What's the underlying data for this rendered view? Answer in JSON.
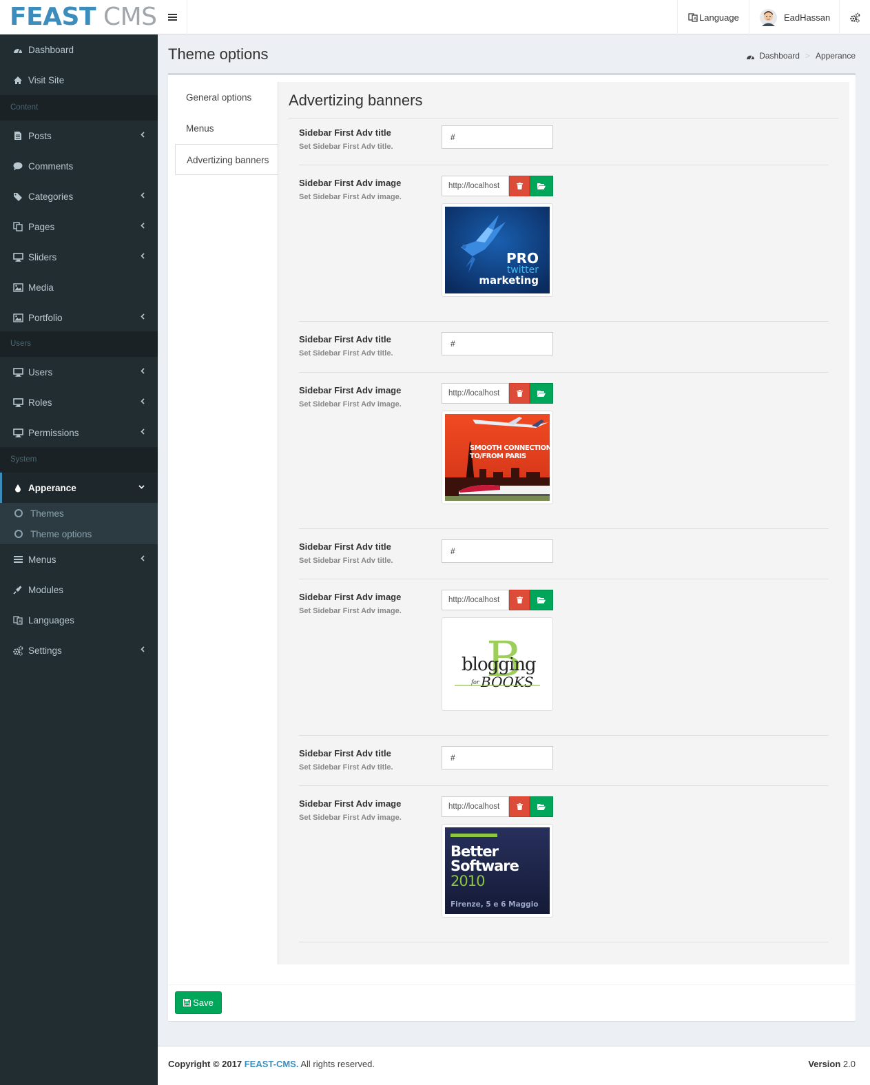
{
  "logo": {
    "part1": "FEAST",
    "part2": "CMS"
  },
  "header": {
    "language_label": "Language",
    "user_name": "EadHassan"
  },
  "sidebar": {
    "items": [
      {
        "label": "Dashboard",
        "icon": "dashboard-icon"
      },
      {
        "label": "Visit Site",
        "icon": "home-icon"
      },
      {
        "label": "Posts",
        "icon": "file-icon"
      },
      {
        "label": "Comments",
        "icon": "comment-icon"
      },
      {
        "label": "Categories",
        "icon": "tags-icon"
      },
      {
        "label": "Pages",
        "icon": "copy-icon"
      },
      {
        "label": "Sliders",
        "icon": "desktop-icon"
      },
      {
        "label": "Media",
        "icon": "image-icon"
      },
      {
        "label": "Portfolio",
        "icon": "image-icon"
      },
      {
        "label": "Users",
        "icon": "desktop-icon"
      },
      {
        "label": "Roles",
        "icon": "desktop-icon"
      },
      {
        "label": "Permissions",
        "icon": "desktop-icon"
      },
      {
        "label": "Apperance",
        "icon": "tint-icon"
      },
      {
        "label": "Menus",
        "icon": "bars-icon"
      },
      {
        "label": "Modules",
        "icon": "plug-icon"
      },
      {
        "label": "Languages",
        "icon": "language-icon"
      },
      {
        "label": "Settings",
        "icon": "cogs-icon"
      }
    ],
    "headers": {
      "content": "Content",
      "users": "Users",
      "system": "System"
    },
    "submenu": {
      "themes": "Themes",
      "theme_options": "Theme options"
    }
  },
  "page": {
    "title": "Theme options",
    "breadcrumb": {
      "home": "Dashboard",
      "current": "Apperance"
    }
  },
  "tabs": [
    "General options",
    "Menus",
    "Advertizing banners"
  ],
  "panel": {
    "title": "Advertizing banners",
    "title_label": "Sidebar First Adv title",
    "title_help": "Set Sidebar First Adv title.",
    "image_label": "Sidebar First Adv image",
    "image_help": "Set Sidebar First Adv image.",
    "banners": [
      {
        "title_value": "#",
        "image_value": "http://localhost",
        "art": {
          "line1": "PRO",
          "line2": "twitter",
          "line3": "marketing"
        }
      },
      {
        "title_value": "#",
        "image_value": "http://localhost",
        "art": {
          "line1": "SMOOTH CONNECTIONS",
          "line2": "TO/FROM PARIS"
        }
      },
      {
        "title_value": "#",
        "image_value": "http://localhost",
        "art": {
          "line1": "blogging",
          "line2": "for",
          "line3": "BOOKS"
        }
      },
      {
        "title_value": "#",
        "image_value": "http://localhost",
        "art": {
          "line1": "Better",
          "line2": "Software",
          "line3": "2010",
          "line4": "Firenze, 5 e 6 Maggio"
        }
      }
    ]
  },
  "actions": {
    "save_label": "Save"
  },
  "footer": {
    "copyright": "Copyright © 2017",
    "brand": "FEAST-CMS.",
    "rights": "All rights reserved.",
    "version_label": "Version",
    "version": "2.0"
  },
  "colors": {
    "brand_blue": "#3c8dbc",
    "sidebar_bg": "#222d32",
    "success": "#00a65a",
    "danger": "#dd4b39"
  }
}
